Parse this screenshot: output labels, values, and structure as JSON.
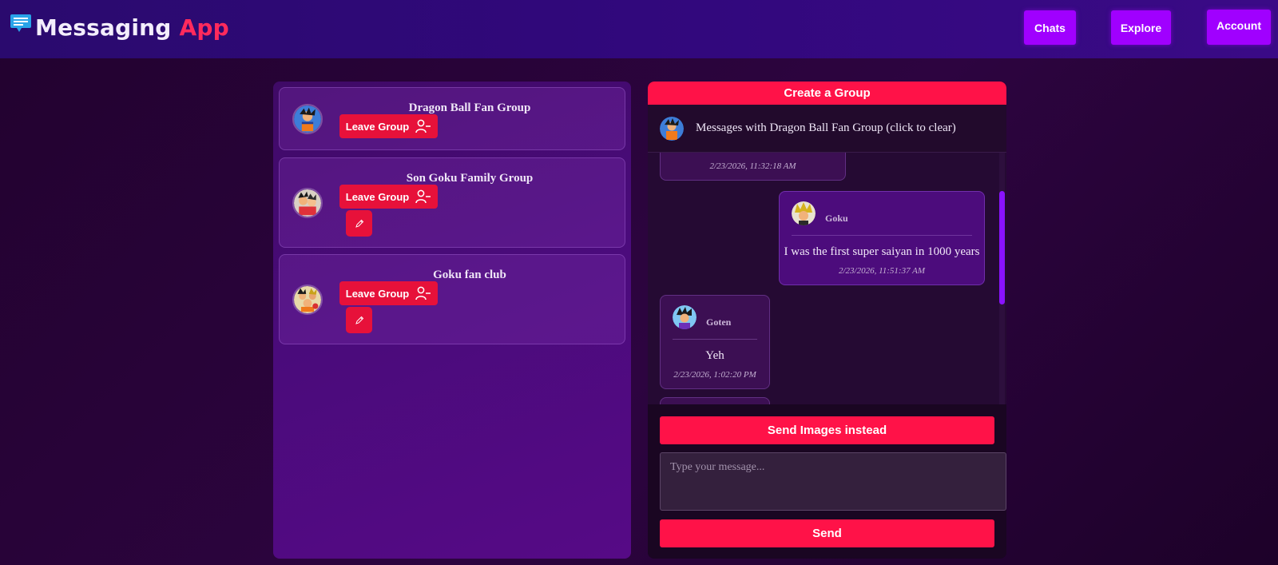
{
  "header": {
    "logo_word1": "Messaging",
    "logo_word2": "App",
    "logo_icon": "chat-bubble-icon",
    "nav": [
      {
        "label": "Chats"
      },
      {
        "label": "Explore"
      },
      {
        "label": "Account"
      }
    ]
  },
  "groups": [
    {
      "name": "Dragon Ball Fan Group",
      "leave_label": "Leave Group",
      "leave_icon": "user-minus-icon",
      "editable": false
    },
    {
      "name": "Son Goku Family Group",
      "leave_label": "Leave Group",
      "leave_icon": "user-minus-icon",
      "editable": true,
      "edit_icon": "pencil-icon"
    },
    {
      "name": "Goku fan club",
      "leave_label": "Leave Group",
      "leave_icon": "user-minus-icon",
      "editable": true,
      "edit_icon": "pencil-icon"
    }
  ],
  "chat": {
    "create_group_label": "Create a Group",
    "header_text": "Messages with Dragon Ball Fan Group (click to clear)",
    "messages": [
      {
        "sender": "",
        "text": "",
        "time": "2/23/2026, 11:32:18 AM",
        "mine": false
      },
      {
        "sender": "Goku",
        "text": "I was the first super saiyan in 1000 years",
        "time": "2/23/2026, 11:51:37 AM",
        "mine": true
      },
      {
        "sender": "Goten",
        "text": "Yeh",
        "time": "2/23/2026, 1:02:20 PM",
        "mine": false
      }
    ],
    "send_images_label": "Send Images instead",
    "input_placeholder": "Type your message...",
    "send_label": "Send"
  },
  "colors": {
    "accent": "#ff1248",
    "nav_button": "#a000ff",
    "header_bg": "#31087c",
    "logo_accent": "#ff2a5c"
  }
}
